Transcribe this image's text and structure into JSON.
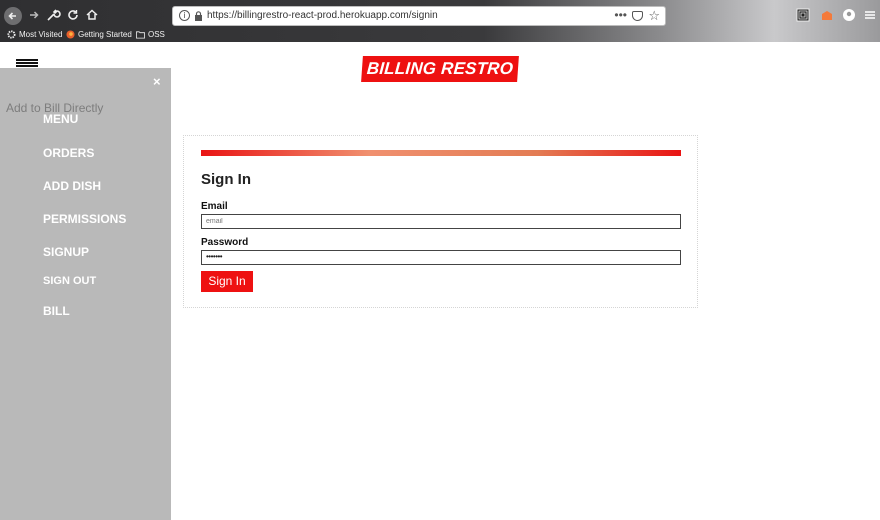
{
  "browser": {
    "url": "https://billingrestro-react-prod.herokuapp.com/signin",
    "overflow_icon": "•••",
    "bookmarks": [
      {
        "label": "Most Visited",
        "icon": "gear-icon"
      },
      {
        "label": "Getting Started",
        "icon": "firefox-icon"
      },
      {
        "label": "OSS",
        "icon": "folder-icon"
      }
    ]
  },
  "app": {
    "logo": "BILLING RESTRO",
    "close_icon": "×",
    "ghost_text": "Add to Bill Directly",
    "sidebar": [
      "MENU",
      "ORDERS",
      "ADD DISH",
      "PERMISSIONS",
      "SIGNUP",
      "SIGN OUT",
      "BILL"
    ]
  },
  "signin": {
    "title": "Sign In",
    "email_label": "Email",
    "email_placeholder": "email",
    "password_label": "Password",
    "password_value": "•••••••",
    "button_label": "Sign In"
  },
  "colors": {
    "brand_red": "#ee1111",
    "sidebar_bg": "#b9b9b9"
  }
}
